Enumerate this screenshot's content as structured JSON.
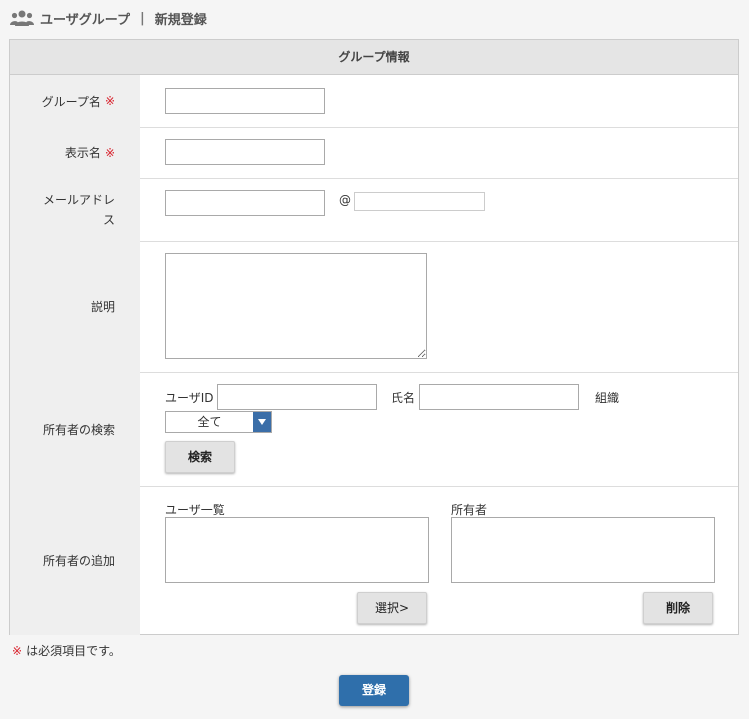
{
  "header": {
    "title": "ユーザグループ",
    "separator": "|",
    "subtitle": "新規登録"
  },
  "form": {
    "section_title": "グループ情報",
    "required_mark": "※",
    "fields": {
      "group_name": {
        "label": "グループ名",
        "value": ""
      },
      "display_name": {
        "label": "表示名",
        "value": ""
      },
      "email": {
        "label": "メールアドレス",
        "at": "@",
        "local": "",
        "domain": ""
      },
      "description": {
        "label": "説明",
        "value": ""
      }
    },
    "owner_search": {
      "label": "所有者の検索",
      "user_id_label": "ユーザID",
      "name_label": "氏名",
      "org_label": "組織",
      "org_selected": "全て",
      "search_button": "検索"
    },
    "owner_add": {
      "label": "所有者の追加",
      "user_list_label": "ユーザ一覧",
      "owner_list_label": "所有者",
      "select_button": "選択>",
      "delete_button": "削除"
    }
  },
  "required_note": "は必須項目です。",
  "submit_button": "登録",
  "colors": {
    "accent": "#2f6fab",
    "required": "#d9232e"
  }
}
